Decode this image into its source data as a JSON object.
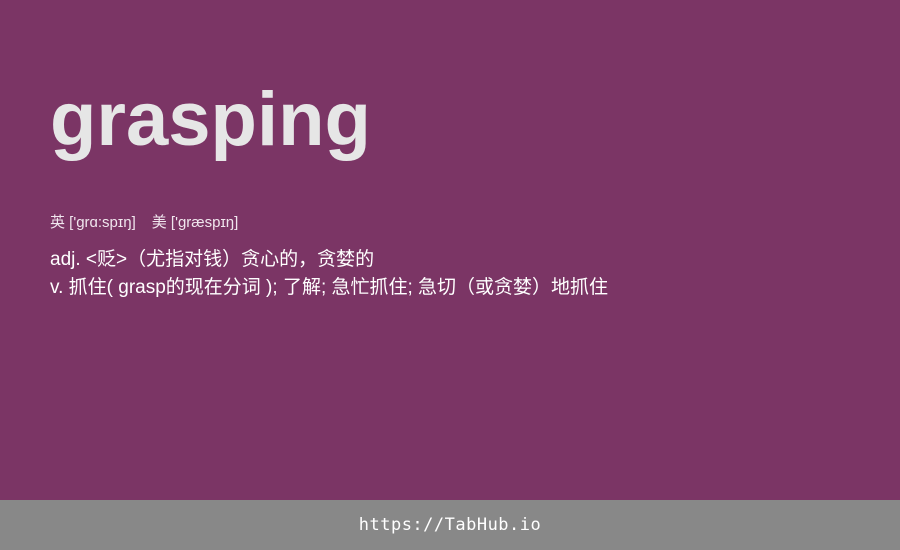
{
  "entry": {
    "word": "grasping",
    "phonetics": {
      "uk": "英 ['grɑ:spɪŋ]",
      "us": "美 ['græspɪŋ]"
    },
    "definitions": [
      "adj. <贬>（尤指对钱）贪心的，贪婪的",
      "v. 抓住( grasp的现在分词 ); 了解; 急忙抓住; 急切（或贪婪）地抓住"
    ]
  },
  "footer": {
    "link": "https://TabHub.io"
  },
  "colors": {
    "background": "#7b3565",
    "word": "#e6e6e6",
    "text": "#ffffff",
    "footer_bg": "#888888"
  }
}
